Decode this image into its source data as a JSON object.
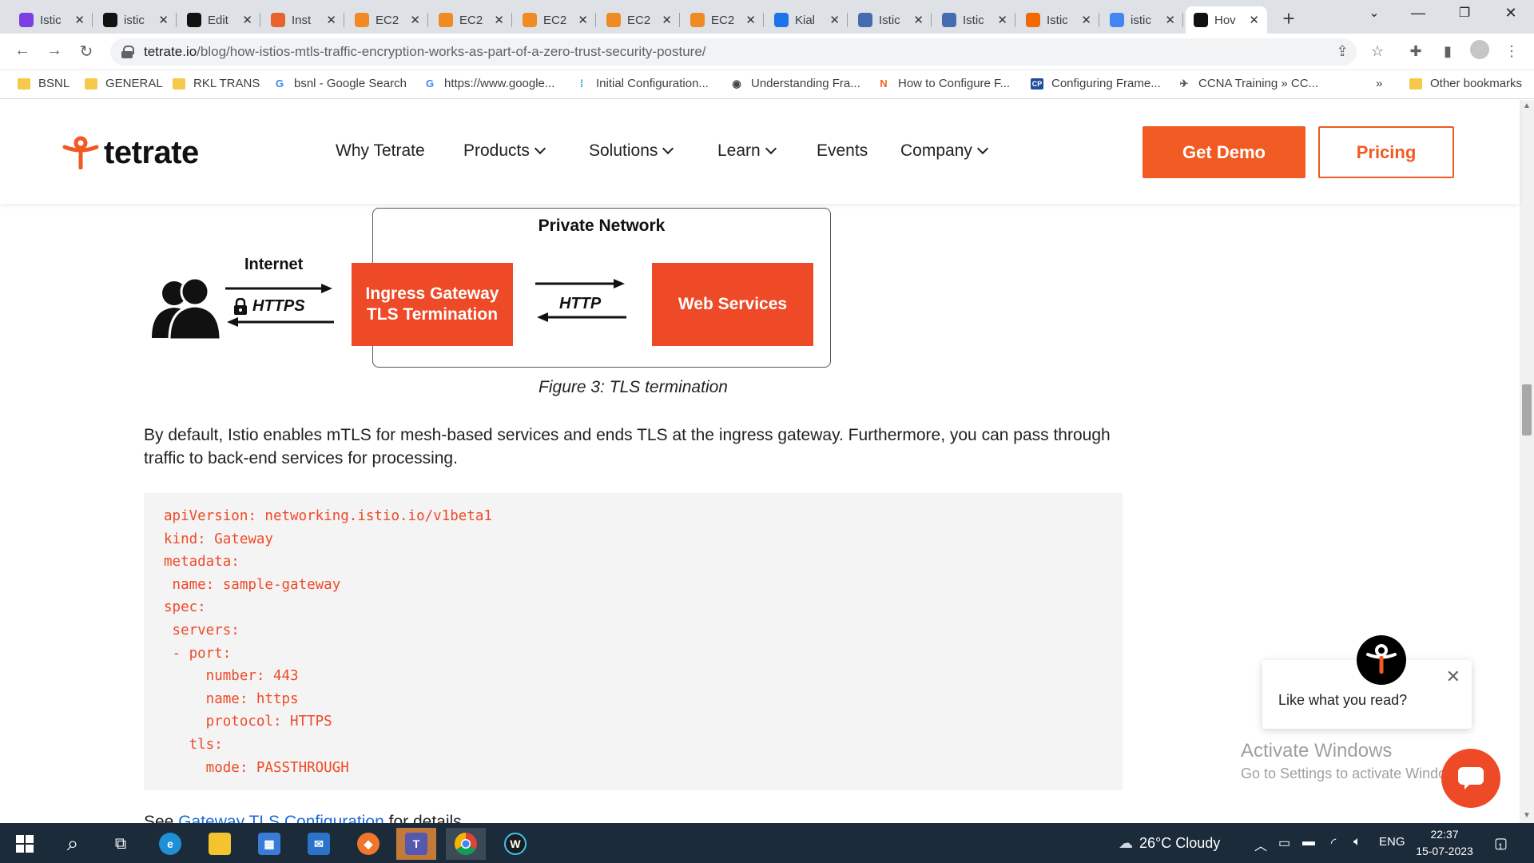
{
  "browser": {
    "tabs": [
      {
        "label": "Istic",
        "icon": "istio-purple-icon",
        "color": "#7b3fe4"
      },
      {
        "label": "istic",
        "icon": "github-icon",
        "color": "#111111"
      },
      {
        "label": "Edit",
        "icon": "github-icon",
        "color": "#111111"
      },
      {
        "label": "Inst",
        "icon": "orange-square-icon",
        "color": "#e8622c"
      },
      {
        "label": "EC2",
        "icon": "aws-cube-icon",
        "color": "#f08a24"
      },
      {
        "label": "EC2",
        "icon": "aws-cube-icon",
        "color": "#f08a24"
      },
      {
        "label": "EC2",
        "icon": "aws-cube-icon",
        "color": "#f08a24"
      },
      {
        "label": "EC2",
        "icon": "aws-cube-icon",
        "color": "#f08a24"
      },
      {
        "label": "EC2",
        "icon": "aws-cube-icon",
        "color": "#f08a24"
      },
      {
        "label": "Kial",
        "icon": "kiali-icon",
        "color": "#1a73e8"
      },
      {
        "label": "Istic",
        "icon": "istio-sail-icon",
        "color": "#466bb0"
      },
      {
        "label": "Istic",
        "icon": "istio-sail-icon",
        "color": "#466bb0"
      },
      {
        "label": "Istic",
        "icon": "grafana-icon",
        "color": "#f46800"
      },
      {
        "label": "istic",
        "icon": "google-icon",
        "color": "#4285f4"
      },
      {
        "label": "Hov",
        "icon": "tetrate-icon",
        "color": "#111111",
        "active": true
      }
    ],
    "url_domain": "tetrate.io",
    "url_path": "/blog/how-istios-mtls-traffic-encryption-works-as-part-of-a-zero-trust-security-posture/",
    "bookmarks": [
      {
        "label": "BSNL",
        "icon": "folder-icon"
      },
      {
        "label": "GENERAL",
        "icon": "folder-icon"
      },
      {
        "label": "RKL TRANS",
        "icon": "folder-icon"
      },
      {
        "label": "bsnl - Google Search",
        "icon": "google-icon"
      },
      {
        "label": "https://www.google...",
        "icon": "google-icon"
      },
      {
        "label": "Initial Configuration...",
        "icon": "cisco-icon"
      },
      {
        "label": "Understanding Fra...",
        "icon": "globe-icon"
      },
      {
        "label": "How to Configure F...",
        "icon": "n-logo-icon"
      },
      {
        "label": "Configuring Frame...",
        "icon": "cp-logo-icon"
      },
      {
        "label": "CCNA Training » CC...",
        "icon": "bird-icon"
      }
    ],
    "more_bookmarks": "»",
    "other_bookmarks": "Other bookmarks"
  },
  "site": {
    "logo_text": "tetrate",
    "nav": [
      {
        "label": "Why Tetrate",
        "dropdown": false
      },
      {
        "label": "Products",
        "dropdown": true
      },
      {
        "label": "Solutions",
        "dropdown": true
      },
      {
        "label": "Learn",
        "dropdown": true
      },
      {
        "label": "Events",
        "dropdown": false
      },
      {
        "label": "Company",
        "dropdown": true
      }
    ],
    "get_demo": "Get Demo",
    "pricing": "Pricing",
    "brand_color": "#f15a22"
  },
  "diagram": {
    "private_network": "Private Network",
    "internet": "Internet",
    "https": "HTTPS",
    "http": "HTTP",
    "ingress_line1": "Ingress Gateway",
    "ingress_line2": "TLS Termination",
    "web_services": "Web Services"
  },
  "article": {
    "caption": "Figure 3: TLS termination",
    "paragraph": "By default, Istio enables mTLS for mesh-based services and ends TLS at the ingress gateway. Furthermore, you can pass through traffic to back-end services for processing.",
    "code": [
      "apiVersion: networking.istio.io/v1beta1",
      "kind: Gateway",
      "metadata:",
      " name: sample-gateway",
      "spec:",
      " servers:",
      " - port:",
      "     number: 443",
      "     name: https",
      "     protocol: HTTPS",
      "   tls:",
      "     mode: PASSTHROUGH"
    ],
    "after_prefix": "See ",
    "after_link": "Gateway TLS Configuration",
    "after_suffix": " for details."
  },
  "chat": {
    "prompt": "Like what you read?"
  },
  "watermark": {
    "line1": "Activate Windows",
    "line2": "Go to Settings to activate Windows."
  },
  "taskbar": {
    "weather": "26°C  Cloudy",
    "lang": "ENG",
    "time": "22:37",
    "date": "15-07-2023",
    "notif_count": "1"
  }
}
